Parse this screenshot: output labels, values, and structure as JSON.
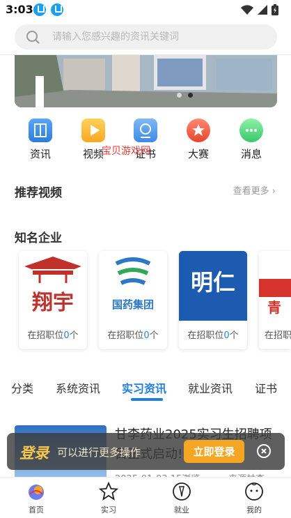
{
  "status_bar": {
    "time": "3:03"
  },
  "search": {
    "placeholder": "请输入您感兴趣的资讯关键词"
  },
  "quick_nav": [
    {
      "label": "资讯",
      "icon": "news-icon"
    },
    {
      "label": "视频",
      "icon": "video-icon"
    },
    {
      "label": "证书",
      "icon": "certificate-icon"
    },
    {
      "label": "大赛",
      "icon": "competition-icon"
    },
    {
      "label": "消息",
      "icon": "message-icon"
    }
  ],
  "overlay_text": "宝贝游戏网",
  "recommended_video": {
    "title": "推荐视频",
    "more": "查看更多"
  },
  "companies": {
    "title": "知名企业",
    "position_prefix": "在招职位",
    "position_suffix": "个",
    "items": [
      {
        "logo_text": "翔宇",
        "count": "0"
      },
      {
        "logo_text": "国药集团",
        "count": "0"
      },
      {
        "logo_text": "明仁",
        "count": "0"
      },
      {
        "logo_text": "青",
        "count": "0"
      }
    ]
  },
  "tabs": {
    "items": [
      "分类",
      "系统资讯",
      "实习资讯",
      "就业资讯",
      "证书"
    ],
    "active": "实习资讯"
  },
  "news": {
    "title": "甘李药业2025实习生招聘项目正式启动!",
    "date": "2025-01-03",
    "views": "15浏览",
    "source": "来源甘李…"
  },
  "login_banner": {
    "title": "登录",
    "hint": "可以进行更多操作",
    "button": "立即登录"
  },
  "bottom_nav": [
    {
      "label": "首页",
      "icon": "home-icon",
      "active": true
    },
    {
      "label": "实习",
      "icon": "star-icon",
      "active": false
    },
    {
      "label": "就业",
      "icon": "briefcase-icon",
      "active": false
    },
    {
      "label": "我的",
      "icon": "profile-icon",
      "active": false
    }
  ],
  "colors": {
    "accent": "#1e7fe0",
    "login_button": "#f5a623",
    "login_title": "#f6c64a",
    "overlay_text": "#e43b3b"
  }
}
